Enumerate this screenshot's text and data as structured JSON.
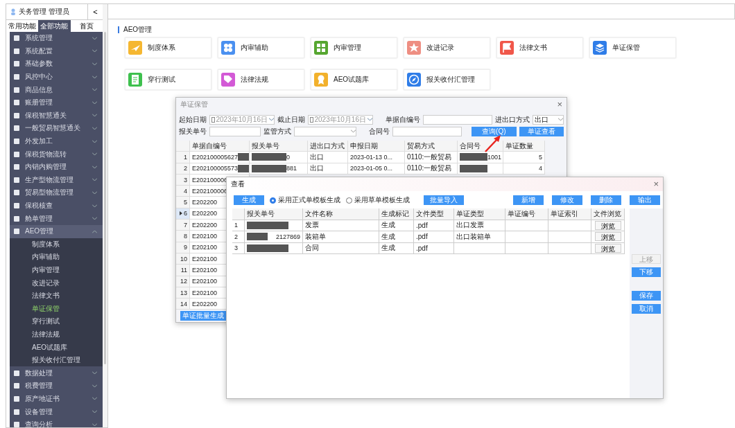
{
  "app_header": {
    "title": "关务管理 管理员",
    "collapse": "<"
  },
  "sidebar_tabs": [
    {
      "label": "常用功能",
      "selected": false
    },
    {
      "label": "全部功能",
      "selected": true
    },
    {
      "label": "首页",
      "selected": false
    }
  ],
  "menu": [
    {
      "label": "系统管理",
      "expanded": false
    },
    {
      "label": "系统配置",
      "expanded": false
    },
    {
      "label": "基础参数",
      "expanded": false
    },
    {
      "label": "风控中心",
      "expanded": false
    },
    {
      "label": "商品信息",
      "expanded": false
    },
    {
      "label": "账册管理",
      "expanded": false
    },
    {
      "label": "保税智慧通关",
      "expanded": false
    },
    {
      "label": "一般贸易智慧通关",
      "expanded": false
    },
    {
      "label": "外发加工",
      "expanded": false
    },
    {
      "label": "保税货物流转",
      "expanded": false
    },
    {
      "label": "内销内购管理",
      "expanded": false
    },
    {
      "label": "生产型物流管理",
      "expanded": false
    },
    {
      "label": "贸易型物流管理",
      "expanded": false
    },
    {
      "label": "保税核查",
      "expanded": false
    },
    {
      "label": "舱单管理",
      "expanded": false
    },
    {
      "label": "AEO管理",
      "expanded": true,
      "children": [
        {
          "label": "制度体系",
          "selected": false
        },
        {
          "label": "内审辅助",
          "selected": false
        },
        {
          "label": "内审管理",
          "selected": false
        },
        {
          "label": "改进记录",
          "selected": false
        },
        {
          "label": "法律文书",
          "selected": false
        },
        {
          "label": "单证保管",
          "selected": true
        },
        {
          "label": "穿行测试",
          "selected": false
        },
        {
          "label": "法律法规",
          "selected": false
        },
        {
          "label": "AEO试题库",
          "selected": false
        },
        {
          "label": "报关收付汇管理",
          "selected": false
        }
      ]
    },
    {
      "label": "数据处理",
      "expanded": false
    },
    {
      "label": "税费管理",
      "expanded": false
    },
    {
      "label": "原产地证书",
      "expanded": false
    },
    {
      "label": "设备管理",
      "expanded": false
    },
    {
      "label": "查询分析",
      "expanded": false
    }
  ],
  "section": {
    "title": "AEO管理"
  },
  "tiles": [
    {
      "label": "制度体系",
      "kind": "plane",
      "color": "#f5b731"
    },
    {
      "label": "内审辅助",
      "kind": "circles",
      "color": "#4a90f0"
    },
    {
      "label": "内审管理",
      "kind": "grid",
      "color": "#56a630"
    },
    {
      "label": "改进记录",
      "kind": "star",
      "color": "#ee8e82"
    },
    {
      "label": "法律文书",
      "kind": "flag",
      "color": "#f0574a"
    },
    {
      "label": "单证保管",
      "kind": "layers",
      "color": "#2f7de8"
    },
    {
      "label": "穿行测试",
      "kind": "doc",
      "color": "#3ec04e"
    },
    {
      "label": "法律法规",
      "kind": "tag",
      "color": "#d35ad6"
    },
    {
      "label": "AEO试题库",
      "kind": "medal",
      "color": "#f2b12c"
    },
    {
      "label": "报关收付汇管理",
      "kind": "compass",
      "color": "#2f7de8"
    }
  ],
  "doc_window": {
    "title": "单证保管",
    "close": "×",
    "filters": {
      "start_label": "起始日期",
      "start_date": {
        "value": "2023年10月16日",
        "checked": false
      },
      "end_label": "截止日期",
      "end_date": {
        "value": "2023年10月16日",
        "checked": false
      },
      "self_no_label": "单据自编号",
      "io_label": "进出口方式",
      "io_value": "出口",
      "decl_label": "报关单号",
      "supervision_label": "监管方式",
      "contract_label": "合同号"
    },
    "buttons": [
      "查询(Q)",
      "单证查看"
    ],
    "columns": [
      "单据自编号",
      "报关单号",
      "进出口方式",
      "申报日期",
      "贸易方式",
      "合同号",
      "单证数量"
    ],
    "rows": [
      {
        "num": "1",
        "selected": false,
        "cells": [
          "E202100005627",
          "0",
          "出口",
          "2023-01-13 0...",
          "0110:一般贸易",
          "1001",
          "5"
        ]
      },
      {
        "num": "2",
        "selected": false,
        "cells": [
          "E202100005573",
          "881",
          "出口",
          "2023-01-05 0...",
          "0110:一般贸易",
          "",
          "4"
        ]
      },
      {
        "num": "3",
        "selected": false,
        "cells": [
          "E202100006"
        ]
      },
      {
        "num": "4",
        "selected": false,
        "cells": [
          "E202100006"
        ]
      },
      {
        "num": "5",
        "selected": false,
        "cells": [
          "E202200"
        ]
      },
      {
        "num": "6",
        "selected": true,
        "cells": [
          "E202200"
        ]
      },
      {
        "num": "7",
        "selected": false,
        "cells": [
          "E202200"
        ]
      },
      {
        "num": "8",
        "selected": false,
        "cells": [
          "E202100"
        ]
      },
      {
        "num": "9",
        "selected": false,
        "cells": [
          "E202100"
        ]
      },
      {
        "num": "10",
        "selected": false,
        "cells": [
          "E202100"
        ]
      },
      {
        "num": "11",
        "selected": false,
        "cells": [
          "E202100"
        ]
      },
      {
        "num": "12",
        "selected": false,
        "cells": [
          "E202100"
        ]
      },
      {
        "num": "13",
        "selected": false,
        "cells": [
          "E202100"
        ]
      },
      {
        "num": "14",
        "selected": false,
        "cells": [
          "E202200"
        ]
      }
    ],
    "batch_button": "单证批量生成"
  },
  "view_window": {
    "title": "查看",
    "close": "×",
    "generate_button": "生成",
    "options": [
      {
        "label": "采用正式单模板生成",
        "selected": true
      },
      {
        "label": "采用草单模板生成",
        "selected": false
      }
    ],
    "import_button": "批量导入",
    "actions": [
      "新增",
      "修改",
      "删除",
      "输出"
    ],
    "columns": [
      "报关单号",
      "文件名称",
      "生成标记",
      "文件类型",
      "单证类型",
      "单证编号",
      "单证索引",
      "文件浏览"
    ],
    "rows": [
      {
        "num": "1",
        "cells": [
          "",
          "发票",
          "生成",
          ".pdf",
          "出口发票",
          "",
          ""
        ],
        "browse": "浏览"
      },
      {
        "num": "2",
        "cells": [
          "2127869",
          "装箱单",
          "生成",
          ".pdf",
          "出口装箱单",
          "",
          ""
        ],
        "browse": "浏览"
      },
      {
        "num": "3",
        "cells": [
          "",
          "合同",
          "生成",
          ".pdf",
          "",
          "",
          ""
        ],
        "browse": "浏览"
      }
    ],
    "side_buttons": [
      {
        "label": "上移",
        "disabled": true
      },
      {
        "label": "下移",
        "disabled": false
      },
      {
        "label": "保存",
        "disabled": false
      },
      {
        "label": "取消",
        "disabled": false
      }
    ]
  }
}
